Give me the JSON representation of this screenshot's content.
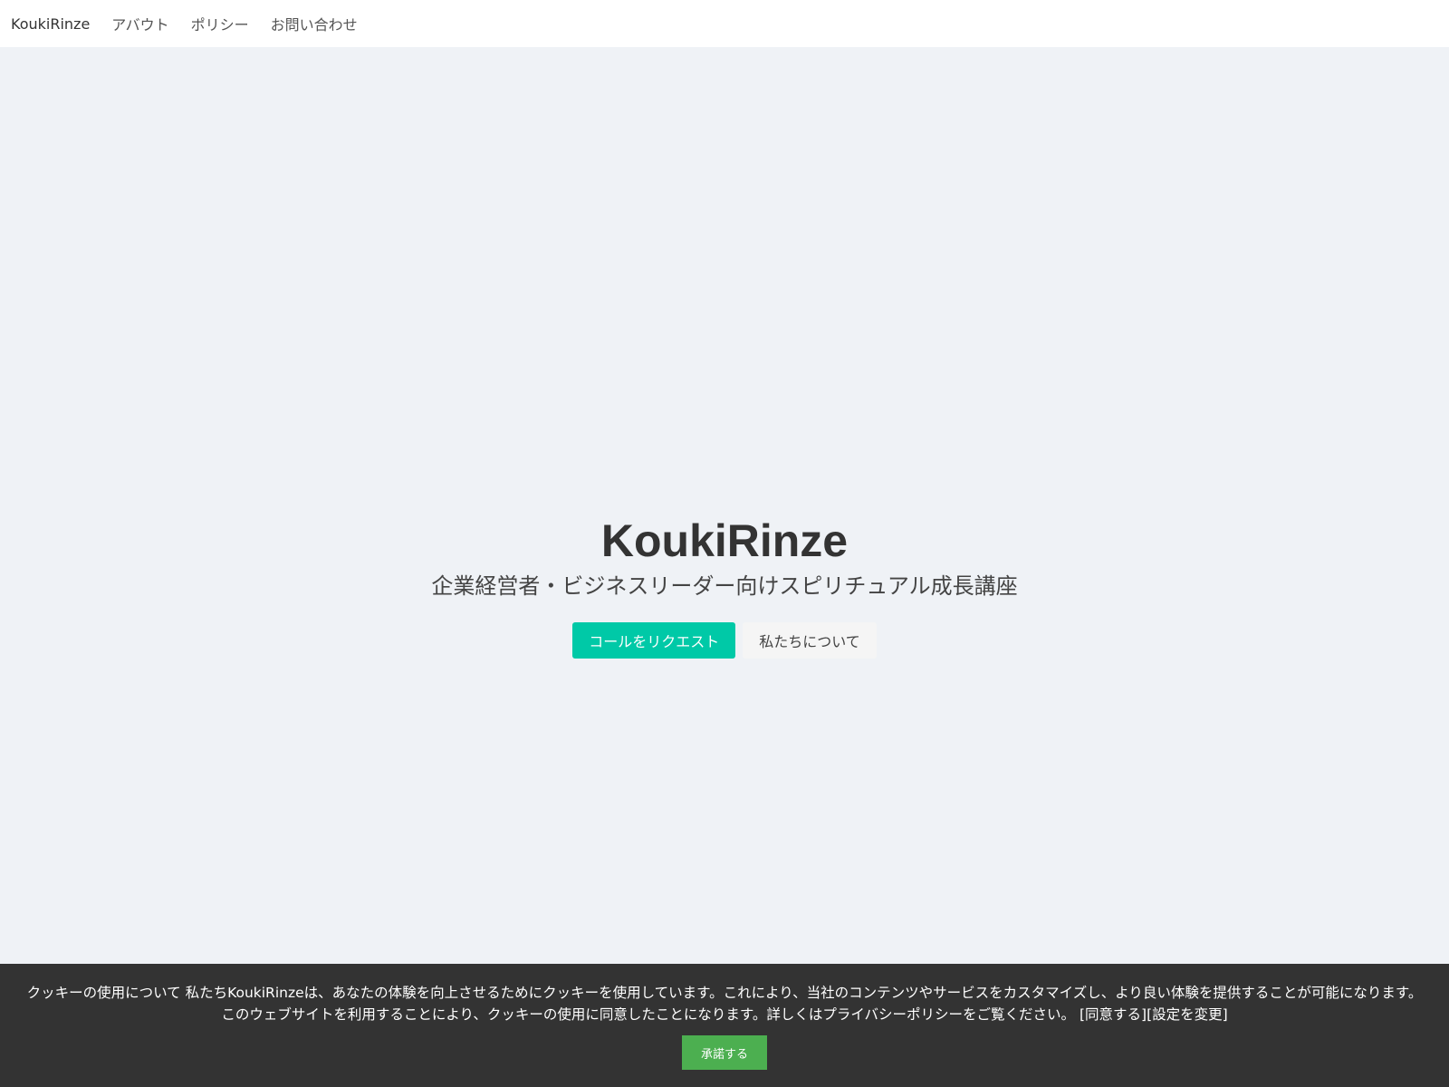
{
  "nav": {
    "brand": "KoukiRinze",
    "links": [
      "アバウト",
      "ポリシー",
      "お問い合わせ"
    ]
  },
  "hero": {
    "title": "KoukiRinze",
    "subtitle": "企業経営者・ビジネスリーダー向けスピリチュアル成長講座",
    "primary_button": "コールをリクエスト",
    "secondary_button": "私たちについて"
  },
  "cookie": {
    "text": "クッキーの使用について 私たちKoukiRinzeは、あなたの体験を向上させるためにクッキーを使用しています。これにより、当社のコンテンツやサービスをカスタマイズし、より良い体験を提供することが可能になります。 このウェブサイトを利用することにより、クッキーの使用に同意したことになります。詳しくはプライバシーポリシーをご覧ください。",
    "agree_link": "[同意する]",
    "settings_link": "[設定を変更]",
    "accept_button": "承諾する"
  },
  "colors": {
    "accent": "#00c9a7",
    "page_background": "#eff2f6",
    "cookie_background": "#333333",
    "accept_button": "#4caf50"
  }
}
